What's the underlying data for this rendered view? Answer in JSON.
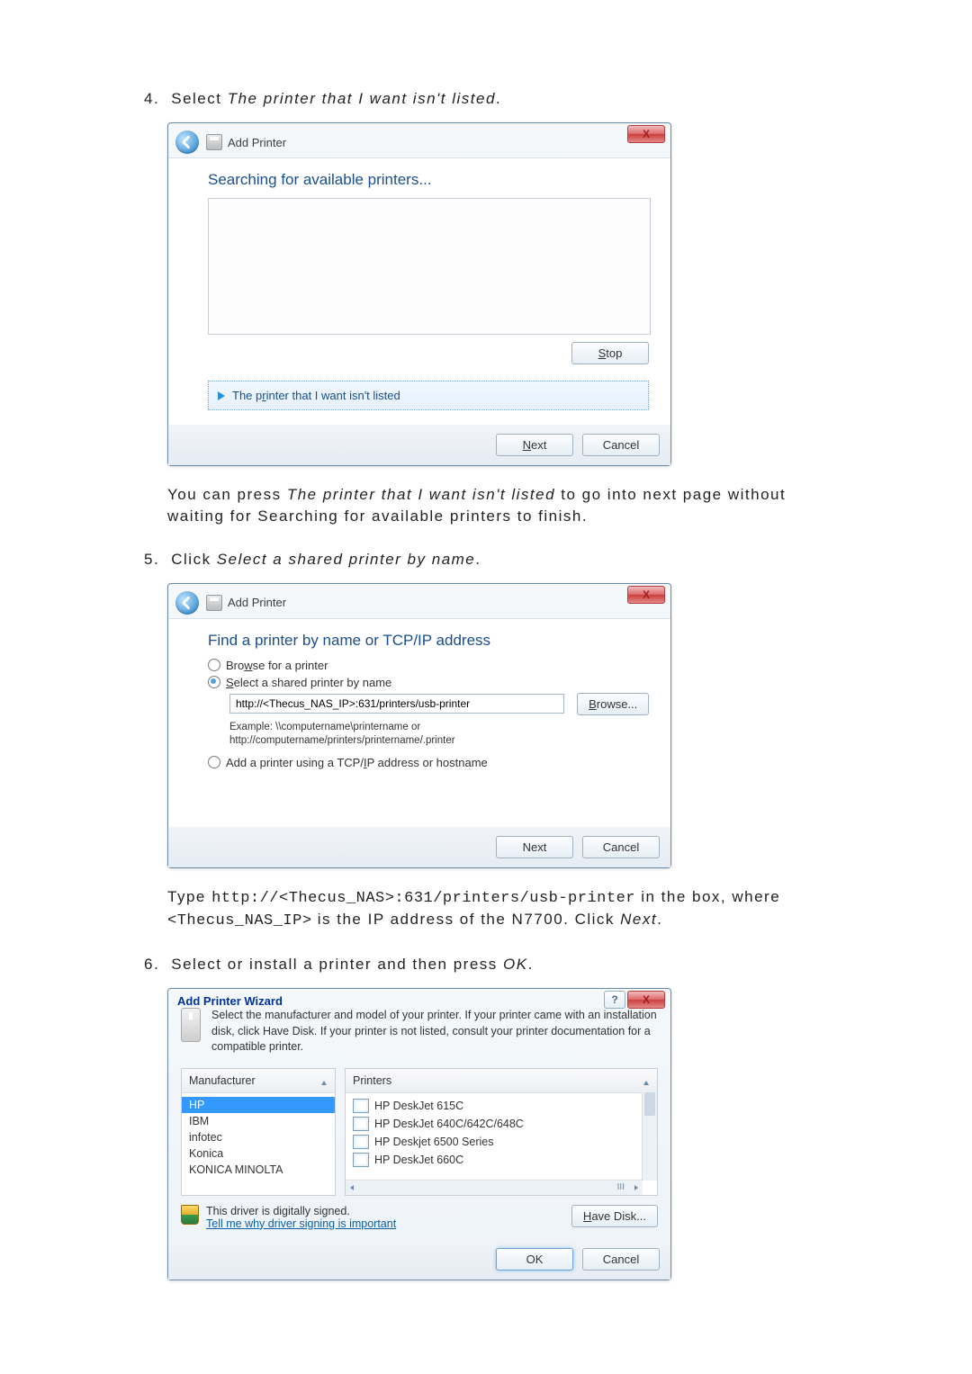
{
  "step4": {
    "num": "4.",
    "prefix": "Select ",
    "italic": "The printer that I want isn't listed",
    "suffix": "."
  },
  "dlg1": {
    "title": "Add Printer",
    "close": "X",
    "heading": "Searching for available printers...",
    "stop": "Stop",
    "stop_u": "S",
    "link_text": "The printer that I want isn't listed",
    "link_u": "r",
    "next": "Next",
    "next_u": "N",
    "cancel": "Cancel"
  },
  "para1": {
    "a": "You can press ",
    "b": "The printer that I want isn't listed",
    "c": " to go into next page without waiting for Searching for available printers to finish."
  },
  "step5": {
    "num": "5.",
    "prefix": "Click ",
    "italic": "Select a shared printer by name",
    "suffix": "."
  },
  "dlg2": {
    "title": "Add Printer",
    "close": "X",
    "heading": "Find a printer by name or TCP/IP address",
    "r1": "Browse for a printer",
    "r1_u": "w",
    "r2": "Select a shared printer by name",
    "r2_u": "S",
    "input": "http://<Thecus_NAS_IP>:631/printers/usb-printer",
    "browse": "Browse...",
    "browse_u": "B",
    "ex1": "Example: \\\\computername\\printername or",
    "ex2": "http://computername/printers/printername/.printer",
    "r3": "Add a printer using a TCP/IP address or hostname",
    "r3_u": "I",
    "next": "Next",
    "cancel": "Cancel"
  },
  "para2": {
    "a": "Type ",
    "code1": "http://<Thecus_NAS>:631/printers/usb-printer",
    "b": " in the box, where ",
    "code2": "<Thecus_NAS_IP>",
    "c": " is the IP address of the N7700. Click ",
    "d": "Next",
    "e": "."
  },
  "step6": {
    "num": "6.",
    "prefix": "Select or install a printer and then press ",
    "italic": "OK",
    "suffix": "."
  },
  "dlg3": {
    "title": "Add Printer Wizard",
    "help": "?",
    "close": "X",
    "info": "Select the manufacturer and model of your printer. If your printer came with an installation disk, click Have Disk. If your printer is not listed, consult your printer documentation for a compatible printer.",
    "mfr_head": "Manufacturer",
    "prn_head": "Printers",
    "mfrs": [
      "HP",
      "IBM",
      "infotec",
      "Konica",
      "KONICA MINOLTA"
    ],
    "prns": [
      "HP DeskJet 615C",
      "HP DeskJet 640C/642C/648C",
      "HP Deskjet 6500 Series",
      "HP DeskJet 660C"
    ],
    "scroll_label": "III",
    "signed": "This driver is digitally signed.",
    "why": "Tell me why driver signing is important",
    "have": "Have Disk...",
    "have_u": "H",
    "ok": "OK",
    "cancel": "Cancel"
  }
}
